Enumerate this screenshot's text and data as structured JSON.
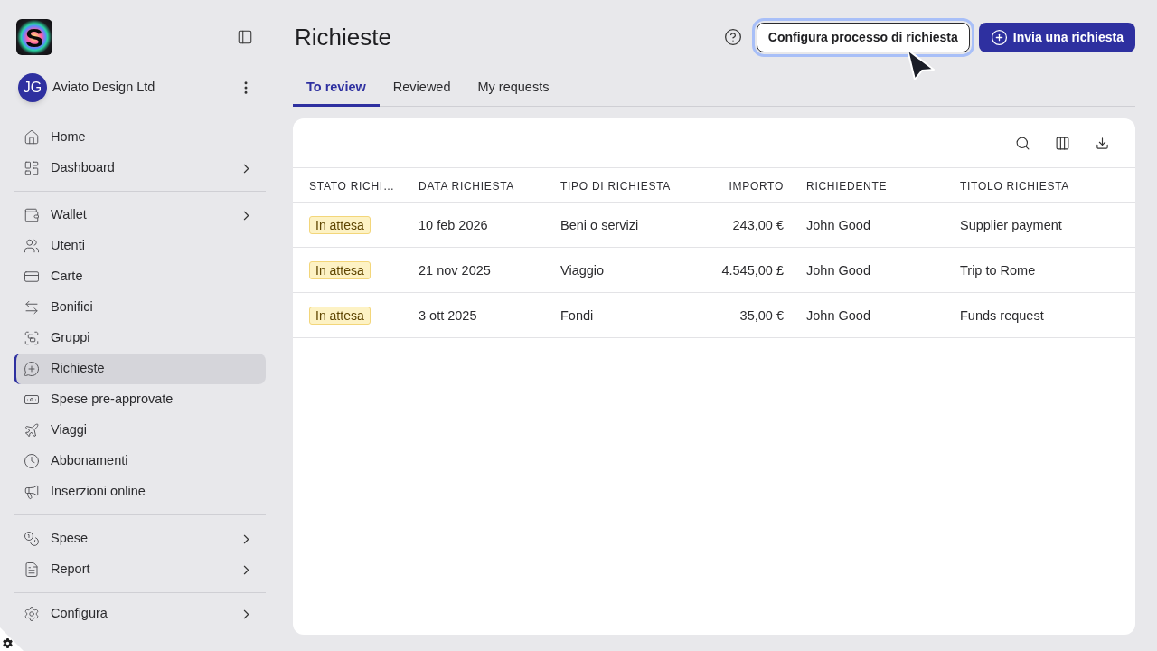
{
  "logo": {
    "letter": "S"
  },
  "account": {
    "initials": "JG",
    "name": "Aviato Design Ltd"
  },
  "sidebar": {
    "groups": [
      {
        "items": [
          {
            "label": "Home",
            "selected": false,
            "expandable": false
          },
          {
            "label": "Dashboard",
            "selected": false,
            "expandable": true
          }
        ]
      },
      {
        "items": [
          {
            "label": "Wallet",
            "selected": false,
            "expandable": true
          },
          {
            "label": "Utenti",
            "selected": false,
            "expandable": false
          },
          {
            "label": "Carte",
            "selected": false,
            "expandable": false
          },
          {
            "label": "Bonifici",
            "selected": false,
            "expandable": false
          },
          {
            "label": "Gruppi",
            "selected": false,
            "expandable": false
          },
          {
            "label": "Richieste",
            "selected": true,
            "expandable": false
          },
          {
            "label": "Spese pre-approvate",
            "selected": false,
            "expandable": false
          },
          {
            "label": "Viaggi",
            "selected": false,
            "expandable": false
          },
          {
            "label": "Abbonamenti",
            "selected": false,
            "expandable": false
          },
          {
            "label": "Inserzioni online",
            "selected": false,
            "expandable": false
          }
        ]
      },
      {
        "items": [
          {
            "label": "Spese",
            "selected": false,
            "expandable": true
          },
          {
            "label": "Report",
            "selected": false,
            "expandable": true
          }
        ]
      },
      {
        "items": [
          {
            "label": "Configura",
            "selected": false,
            "expandable": true
          }
        ]
      }
    ]
  },
  "header": {
    "title": "Richieste",
    "actions": [
      {
        "label": "Configura processo di richiesta",
        "kind": "secondary",
        "focused": true
      },
      {
        "label": "Invia una richiesta",
        "kind": "primary",
        "focused": false
      }
    ]
  },
  "tabs": [
    {
      "label": "To review",
      "selected": true
    },
    {
      "label": "Reviewed",
      "selected": false
    },
    {
      "label": "My requests",
      "selected": false
    }
  ],
  "table": {
    "columns": [
      {
        "label": "STATO RICHI…",
        "kind": "status"
      },
      {
        "label": "DATA RICHIESTA",
        "kind": "text"
      },
      {
        "label": "TIPO DI RICHIESTA",
        "kind": "text"
      },
      {
        "label": "IMPORTO",
        "kind": "amount"
      },
      {
        "label": "RICHIEDENTE",
        "kind": "text"
      },
      {
        "label": "TITOLO RICHIESTA",
        "kind": "text"
      }
    ],
    "rows": [
      {
        "cells": [
          "In attesa",
          "10 feb 2026",
          "Beni o servizi",
          "243,00 €",
          "John Good",
          "Supplier payment"
        ]
      },
      {
        "cells": [
          "In attesa",
          "21 nov 2025",
          "Viaggio",
          "4.545,00 £",
          "John Good",
          "Trip to Rome"
        ]
      },
      {
        "cells": [
          "In attesa",
          "3 ott 2025",
          "Fondi",
          "35,00 €",
          "John Good",
          "Funds request"
        ]
      }
    ]
  }
}
